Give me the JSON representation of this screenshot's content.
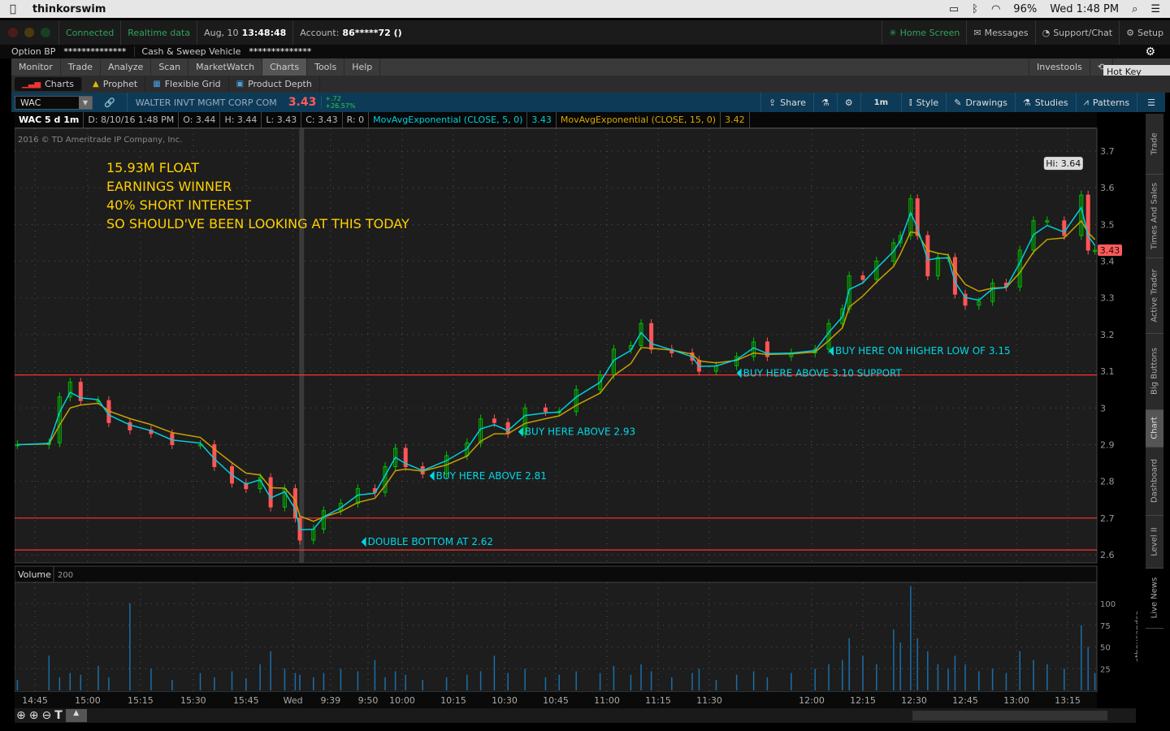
{
  "macbar": {
    "app": "thinkorswim",
    "battery": "96%",
    "clock": "Wed 1:48 PM"
  },
  "topbar": {
    "connected": "Connected",
    "realtime": "Realtime data",
    "date": "Aug, 10",
    "time": "13:48:48",
    "account_label": "Account:",
    "account": "86*****72 ()",
    "home": "Home Screen",
    "messages": "Messages",
    "support": "Support/Chat",
    "setup": "Setup"
  },
  "bp": {
    "option_bp": "Option BP",
    "option_bp_val": "**************",
    "cash": "Cash & Sweep Vehicle",
    "cash_val": "**************"
  },
  "menu": {
    "tabs": [
      "Monitor",
      "Trade",
      "Analyze",
      "Scan",
      "MarketWatch",
      "Charts",
      "Tools",
      "Help"
    ],
    "active": "Charts",
    "investools": "Investools",
    "tooltip": "Hot Key Setup"
  },
  "subtabs": [
    "Charts",
    "Prophet",
    "Flexible Grid",
    "Product Depth"
  ],
  "toolbar": {
    "symbol": "WAC",
    "company": "WALTER INVT MGMT CORP COM",
    "last": "3.43",
    "change": "+.72",
    "change_pct": "+26.57%",
    "share": "Share",
    "interval": "1m",
    "style": "Style",
    "drawings": "Drawings",
    "studies": "Studies",
    "patterns": "Patterns"
  },
  "header": {
    "title": "WAC 5 d 1m",
    "d": "D: 8/10/16 1:48 PM",
    "o": "O: 3.44",
    "h": "H: 3.44",
    "l": "L: 3.43",
    "c": "C: 3.43",
    "r": "R: 0",
    "ema5": "MovAvgExponential (CLOSE, 5, 0)",
    "ema5_val": "3.43",
    "ema15": "MovAvgExponential (CLOSE, 15, 0)",
    "ema15_val": "3.42"
  },
  "right_tabs": [
    "Trade",
    "Times And Sales",
    "Active Trader",
    "Big Buttons",
    "Chart",
    "Dashboard",
    "Level II",
    "Live News"
  ],
  "right_tabs_active": "Chart",
  "chart_data": {
    "type": "candlestick",
    "copyright": "2016 © TD Ameritrade IP Company, Inc.",
    "notes": [
      "15.93M FLOAT",
      "EARNINGS WINNER",
      "40% SHORT INTEREST",
      "SO SHOULD'VE BEEN LOOKING AT THIS TODAY"
    ],
    "ylim": [
      2.58,
      3.74
    ],
    "yticks": [
      3.7,
      3.6,
      3.5,
      3.4,
      3.3,
      3.2,
      3.1,
      3,
      2.9,
      2.8,
      2.7,
      2.6
    ],
    "ytick_labels": [
      "3.7",
      "3.6",
      "3.5",
      "3.4",
      "3.3",
      "3.2",
      "3.1",
      "3",
      "2.9",
      "2.8",
      "2.7",
      "2.6"
    ],
    "last_price_label": "3.43",
    "hi_label": "Hi: 3.64",
    "hi": {
      "t": "08-10 13:19",
      "p": 3.64
    },
    "hlines": [
      3.09,
      2.7,
      2.613
    ],
    "session_break": "08-09 16:00",
    "annotations": [
      {
        "t": "08-10 09:48",
        "p": 2.635,
        "text": "DOUBLE BOTTOM AT 2.62"
      },
      {
        "t": "08-10 10:08",
        "p": 2.815,
        "text": "BUY HERE ABOVE 2.81"
      },
      {
        "t": "08-10 10:34",
        "p": 2.935,
        "text": "BUY HERE ABOVE 2.93"
      },
      {
        "t": "08-10 11:38",
        "p": 3.095,
        "text": "BUY HERE ABOVE 3.10 SUPPORT"
      },
      {
        "t": "08-10 12:05",
        "p": 3.155,
        "text": "BUY HERE ON HIGHER LOW OF 3.15"
      }
    ],
    "studies": [
      {
        "name": "MovAvgExponential (CLOSE, 5, 0)",
        "color": "#00d0dc"
      },
      {
        "name": "MovAvgExponential (CLOSE, 15, 0)",
        "color": "#c8a000"
      }
    ],
    "colors": {
      "up": "#00c000",
      "down": "#ff5555",
      "volume": "#1a6fa8",
      "annotation": "#00d8e8",
      "notes": "#ffd000",
      "hline": "#ff3030"
    },
    "xticks": [
      [
        "08-09 14:45",
        "14:45"
      ],
      [
        "08-09 15:00",
        "15:00"
      ],
      [
        "08-09 15:15",
        "15:15"
      ],
      [
        "08-09 15:30",
        "15:30"
      ],
      [
        "08-09 15:45",
        "15:45"
      ],
      [
        "08-10 09:28",
        "Wed"
      ],
      [
        "08-10 09:39",
        "9:39"
      ],
      [
        "08-10 09:50",
        "9:50"
      ],
      [
        "08-10 10:00",
        "10:00"
      ],
      [
        "08-10 10:15",
        "10:15"
      ],
      [
        "08-10 10:30",
        "10:30"
      ],
      [
        "08-10 10:45",
        "10:45"
      ],
      [
        "08-10 11:00",
        "11:00"
      ],
      [
        "08-10 11:15",
        "11:15"
      ],
      [
        "08-10 11:30",
        "11:30"
      ],
      [
        "08-10 12:00",
        "12:00"
      ],
      [
        "08-10 12:15",
        "12:15"
      ],
      [
        "08-10 12:30",
        "12:30"
      ],
      [
        "08-10 12:45",
        "12:45"
      ],
      [
        "08-10 13:00",
        "13:00"
      ],
      [
        "08-10 13:15",
        "13:15"
      ]
    ],
    "volume": {
      "label": "Volume",
      "value": "200",
      "ylim": [
        0,
        140
      ],
      "yticks": [
        0,
        25,
        50,
        75,
        100
      ],
      "ytick_labels": [
        "0",
        "25",
        "50",
        "75",
        "100"
      ],
      "unit": "<thousands>"
    },
    "bars": [
      [
        "08-09 14:40",
        2.9,
        12
      ],
      [
        "08-09 14:49",
        2.905,
        40
      ],
      [
        "08-09 14:52",
        3.03,
        15
      ],
      [
        "08-09 14:55",
        3.07,
        20
      ],
      [
        "08-09 14:58",
        3.02,
        18
      ],
      [
        "08-09 15:03",
        3.02,
        28
      ],
      [
        "08-09 15:06",
        2.96,
        15
      ],
      [
        "08-09 15:12",
        2.94,
        100
      ],
      [
        "08-09 15:18",
        2.93,
        25
      ],
      [
        "08-09 15:24",
        2.9,
        12
      ],
      [
        "08-09 15:32",
        2.9,
        20
      ],
      [
        "08-09 15:36",
        2.84,
        15
      ],
      [
        "08-09 15:41",
        2.795,
        22
      ],
      [
        "08-09 15:45",
        2.78,
        14
      ],
      [
        "08-09 15:49",
        2.81,
        30
      ],
      [
        "08-09 15:52",
        2.73,
        45
      ],
      [
        "08-09 15:56",
        2.78,
        25
      ],
      [
        "08-09 15:59",
        2.7,
        20
      ],
      [
        "08-10 09:30",
        2.64,
        18
      ],
      [
        "08-10 09:34",
        2.67,
        15
      ],
      [
        "08-10 09:37",
        2.72,
        20
      ],
      [
        "08-10 09:42",
        2.74,
        25
      ],
      [
        "08-10 09:47",
        2.78,
        22
      ],
      [
        "08-10 09:52",
        2.77,
        35
      ],
      [
        "08-10 09:55",
        2.84,
        15
      ],
      [
        "08-10 09:58",
        2.89,
        22
      ],
      [
        "08-10 10:01",
        2.84,
        18
      ],
      [
        "08-10 10:06",
        2.82,
        12
      ],
      [
        "08-10 10:13",
        2.87,
        15
      ],
      [
        "08-10 10:19",
        2.905,
        18
      ],
      [
        "08-10 10:23",
        2.97,
        22
      ],
      [
        "08-10 10:27",
        2.96,
        40
      ],
      [
        "08-10 10:31",
        2.93,
        20
      ],
      [
        "08-10 10:36",
        3.0,
        25
      ],
      [
        "08-10 10:42",
        2.99,
        15
      ],
      [
        "08-10 10:46",
        2.99,
        18
      ],
      [
        "08-10 10:51",
        3.05,
        22
      ],
      [
        "08-10 10:58",
        3.09,
        20
      ],
      [
        "08-10 11:02",
        3.16,
        28
      ],
      [
        "08-10 11:07",
        3.17,
        18
      ],
      [
        "08-10 11:10",
        3.23,
        30
      ],
      [
        "08-10 11:13",
        3.16,
        22
      ],
      [
        "08-10 11:19",
        3.15,
        15
      ],
      [
        "08-10 11:25",
        3.13,
        20
      ],
      [
        "08-10 11:27",
        3.1,
        25
      ],
      [
        "08-10 11:32",
        3.115,
        12
      ],
      [
        "08-10 11:38",
        3.14,
        18
      ],
      [
        "08-10 11:43",
        3.18,
        22
      ],
      [
        "08-10 11:47",
        3.14,
        15
      ],
      [
        "08-10 11:54",
        3.15,
        20
      ],
      [
        "08-10 12:01",
        3.16,
        25
      ],
      [
        "08-10 12:05",
        3.23,
        30
      ],
      [
        "08-10 12:09",
        3.27,
        35
      ],
      [
        "08-10 12:11",
        3.36,
        60
      ],
      [
        "08-10 12:15",
        3.35,
        40
      ],
      [
        "08-10 12:19",
        3.4,
        30
      ],
      [
        "08-10 12:24",
        3.45,
        70
      ],
      [
        "08-10 12:26",
        3.47,
        55
      ],
      [
        "08-10 12:29",
        3.57,
        120
      ],
      [
        "08-10 12:31",
        3.47,
        60
      ],
      [
        "08-10 12:34",
        3.36,
        45
      ],
      [
        "08-10 12:37",
        3.41,
        30
      ],
      [
        "08-10 12:40",
        3.41,
        25
      ],
      [
        "08-10 12:42",
        3.31,
        40
      ],
      [
        "08-10 12:45",
        3.28,
        30
      ],
      [
        "08-10 12:49",
        3.29,
        22
      ],
      [
        "08-10 12:53",
        3.34,
        25
      ],
      [
        "08-10 12:57",
        3.33,
        20
      ],
      [
        "08-10 13:01",
        3.43,
        45
      ],
      [
        "08-10 13:05",
        3.51,
        35
      ],
      [
        "08-10 13:09",
        3.51,
        30
      ],
      [
        "08-10 13:14",
        3.47,
        25
      ],
      [
        "08-10 13:19",
        3.58,
        75
      ],
      [
        "08-10 13:21",
        3.43,
        50
      ],
      [
        "08-10 13:23",
        3.43,
        20
      ]
    ]
  }
}
